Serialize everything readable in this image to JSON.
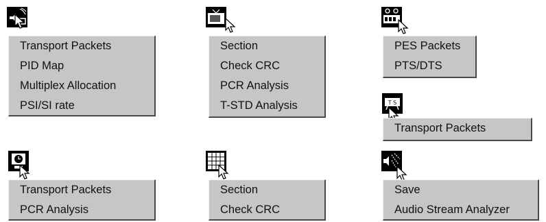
{
  "menus": [
    {
      "icon": "speaker-monitor-icon",
      "items": [
        "Transport Packets",
        "PID Map",
        "Multiplex Allocation",
        "PSI/SI rate"
      ]
    },
    {
      "icon": "tv-icon",
      "items": [
        "Section",
        "Check CRC",
        "PCR Analysis",
        "T-STD Analysis"
      ]
    },
    {
      "icon": "scissors-film-icon",
      "items": [
        "PES Packets",
        "PTS/DTS"
      ]
    },
    {
      "icon": "ts-box-icon",
      "items": [
        "Transport Packets"
      ]
    },
    {
      "icon": "clock-monitor-icon",
      "items": [
        "Transport Packets",
        "PCR Analysis"
      ]
    },
    {
      "icon": "grid-table-icon",
      "items": [
        "Section",
        "Check CRC"
      ]
    },
    {
      "icon": "speaker-waves-icon",
      "items": [
        "Save",
        "Audio Stream Analyzer"
      ]
    }
  ]
}
